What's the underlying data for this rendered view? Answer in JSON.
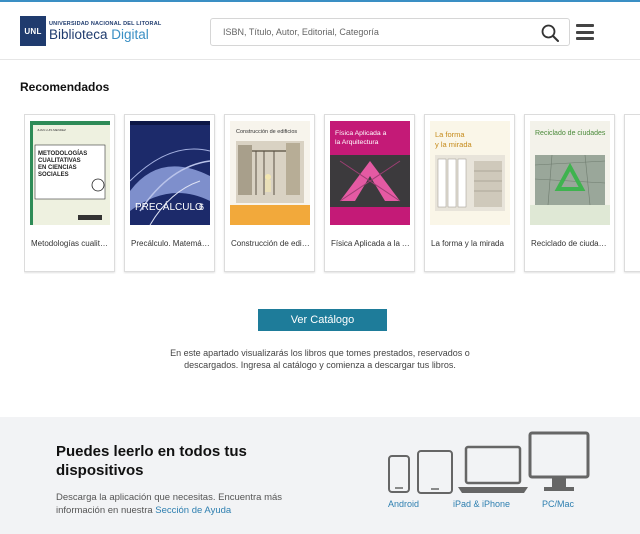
{
  "header": {
    "logo_abbr": "UNL",
    "logo_university": "UNIVERSIDAD NACIONAL DEL LITORAL",
    "logo_name_main": "Biblioteca",
    "logo_name_sub": " Digital",
    "search_placeholder": "ISBN, Título, Autor, Editorial, Categoría",
    "search_value": ""
  },
  "recommended": {
    "title": "Recomendados",
    "books": [
      {
        "title": "Metodologías cualitativas en ciencias sociales",
        "cover_title": "METODOLOGÍAS CUALITATIVAS EN CIENCIAS SOCIALES",
        "cover_author": "JUAN LUIS MENDEZ"
      },
      {
        "title": "Precálculo. Matemáticas para el cálculo",
        "cover_title": "PRECÁLCULO",
        "cover_edition": "6"
      },
      {
        "title": "Construcción de edificios",
        "cover_title": "Construcción de edificios"
      },
      {
        "title": "Física Aplicada a la Arquitectura",
        "cover_title": "Física Aplicada a la Arquitectura"
      },
      {
        "title": "La forma y la mirada",
        "cover_title": "La forma y la mirada"
      },
      {
        "title": "Reciclado de ciudades",
        "cover_title": "Reciclado de ciudades"
      }
    ]
  },
  "catalog_button": "Ver Catálogo",
  "info_text": "En este apartado visualizarás los libros que tomes prestados, reservados o descargados. Ingresa al catálogo y comienza a descargar tus libros.",
  "devices": {
    "title": "Puedes leerlo en todos tus dispositivos",
    "text": "Descarga la aplicación que necesitas. Encuentra más información en nuestra ",
    "help_link": "Sección de Ayuda",
    "android": "Android",
    "ipad_iphone": "iPad & iPhone",
    "pc_mac": "PC/Mac"
  },
  "colors": {
    "accent": "#1e7c9a",
    "link": "#2e7fb0",
    "brand": "#1f3b6e"
  }
}
